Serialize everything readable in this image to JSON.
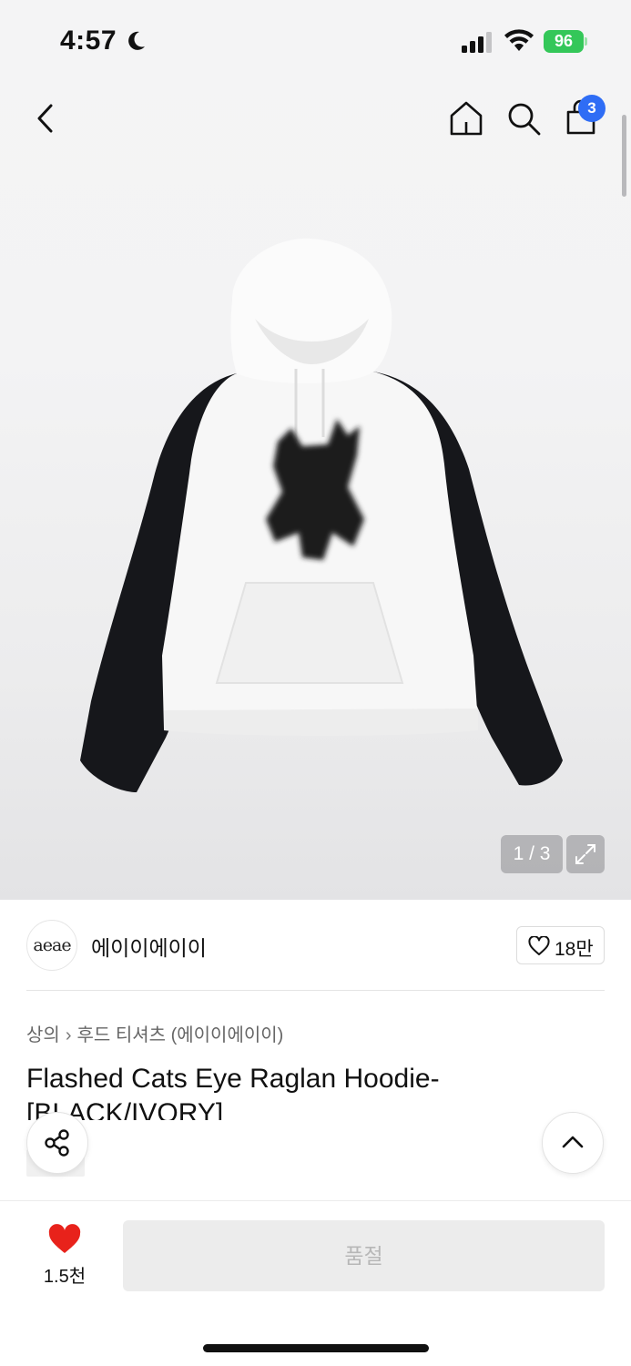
{
  "status_bar": {
    "time": "4:57",
    "battery": "96",
    "icons": [
      "moon-icon",
      "signal-icon",
      "wifi-icon",
      "battery-icon"
    ]
  },
  "nav": {
    "icons": [
      "chevron-left-icon",
      "home-icon",
      "search-icon",
      "shopping-bag-icon"
    ],
    "cart_count": "3"
  },
  "gallery": {
    "counter": "1 / 3",
    "image": "white-black-raglan-hoodie"
  },
  "brand": {
    "logo_text": "aeae",
    "name": "에이이에이이",
    "like_count": "18만"
  },
  "product": {
    "breadcrumb": [
      "상의",
      "후드 티셔츠 (에이이에이이)"
    ],
    "title": "Flashed Cats Eye Raglan Hoodie-[BLACK/IVORY]"
  },
  "bottom_bar": {
    "wish_count": "1.5천",
    "soldout_label": "품절"
  },
  "colors": {
    "accent": "#2f6df5",
    "heart": "#e8221b",
    "battery": "#34c759"
  }
}
